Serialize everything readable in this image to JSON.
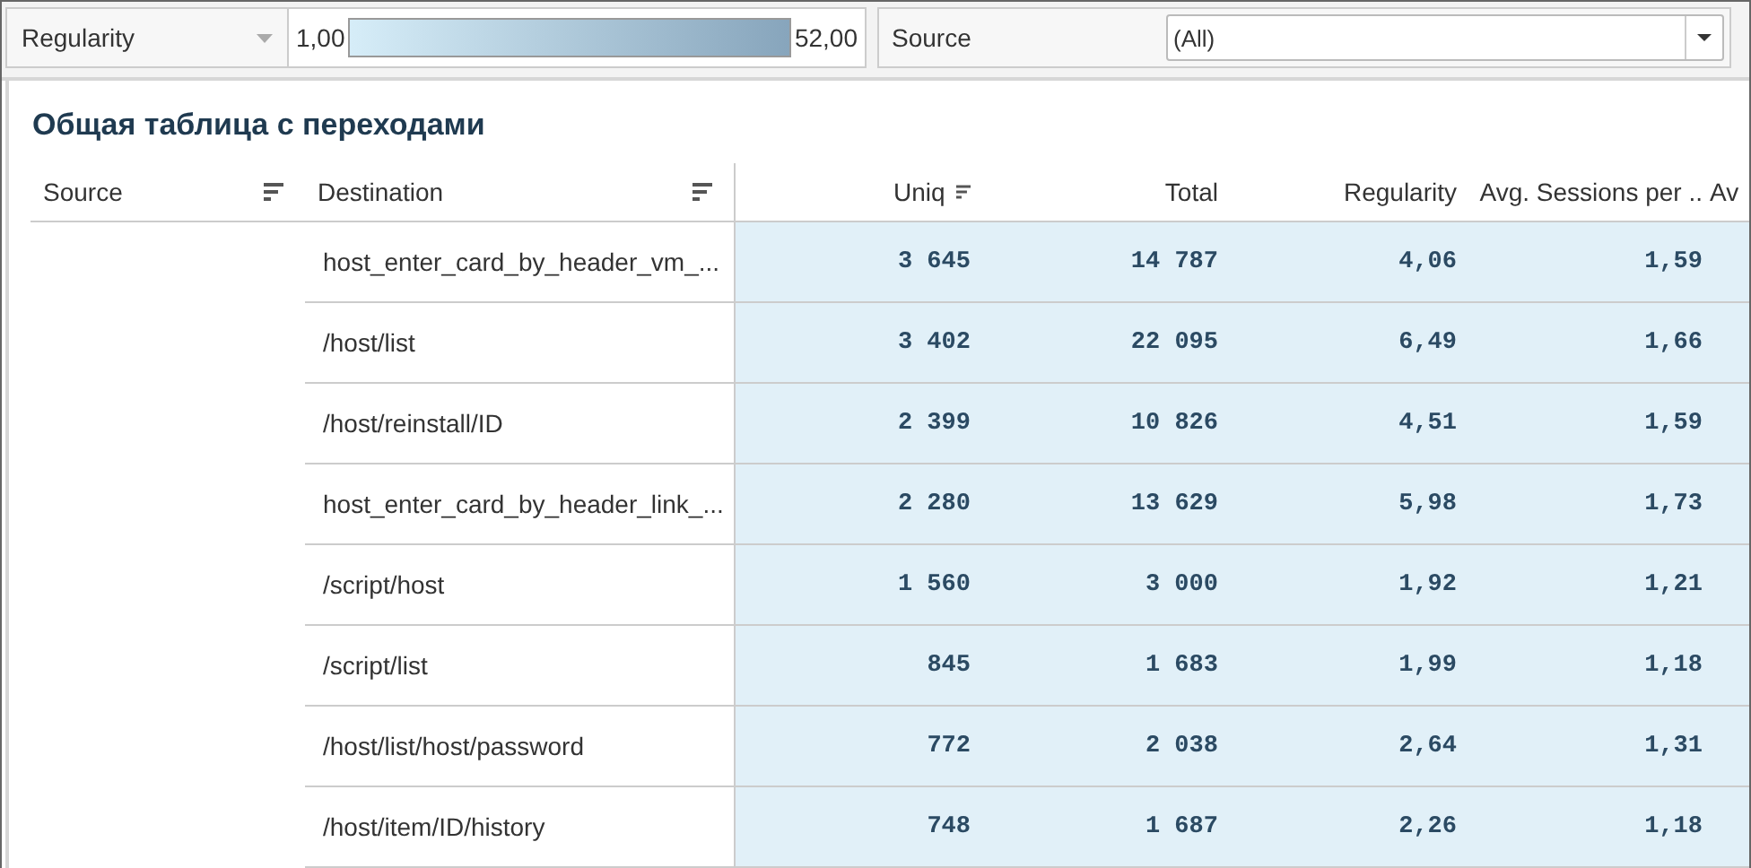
{
  "filters": {
    "measure": {
      "value": "Regularity"
    },
    "legend": {
      "min": "1,00",
      "max": "52,00"
    },
    "source": {
      "label": "Source",
      "value": "(All)"
    }
  },
  "title": "Общая таблица с переходами",
  "table": {
    "columns": [
      {
        "label": "Source",
        "sortable": true
      },
      {
        "label": "Destination",
        "sortable": true
      },
      {
        "label": "Uniq",
        "sortable": true
      },
      {
        "label": "Total",
        "sortable": false
      },
      {
        "label": "Regularity",
        "sortable": false
      },
      {
        "label": "Avg. Sessions per ..",
        "sortable": false
      },
      {
        "label": "Av",
        "sortable": false
      }
    ],
    "rows": [
      {
        "destination": "host_enter_card_by_header_vm_...",
        "values": [
          "3 645",
          "14 787",
          "4,06",
          "1,59"
        ]
      },
      {
        "destination": "/host/list",
        "values": [
          "3 402",
          "22 095",
          "6,49",
          "1,66"
        ]
      },
      {
        "destination": "/host/reinstall/ID",
        "values": [
          "2 399",
          "10 826",
          "4,51",
          "1,59"
        ]
      },
      {
        "destination": "host_enter_card_by_header_link_...",
        "values": [
          "2 280",
          "13 629",
          "5,98",
          "1,73"
        ]
      },
      {
        "destination": "/script/host",
        "values": [
          "1 560",
          "3 000",
          "1,92",
          "1,21"
        ]
      },
      {
        "destination": "/script/list",
        "values": [
          "845",
          "1 683",
          "1,99",
          "1,18"
        ]
      },
      {
        "destination": "/host/list/host/password",
        "values": [
          "772",
          "2 038",
          "2,64",
          "1,31"
        ]
      },
      {
        "destination": "/host/item/ID/history",
        "values": [
          "748",
          "1 687",
          "2,26",
          "1,18"
        ]
      }
    ]
  }
}
